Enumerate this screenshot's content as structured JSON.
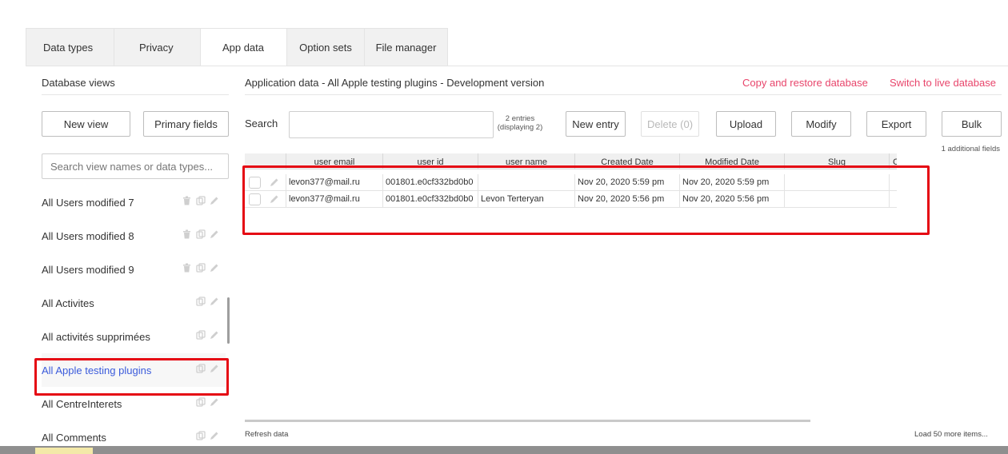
{
  "tabs": [
    {
      "label": "Data types",
      "active": false
    },
    {
      "label": "Privacy",
      "active": false
    },
    {
      "label": "App data",
      "active": true
    },
    {
      "label": "Option sets",
      "active": false
    },
    {
      "label": "File manager",
      "active": false
    }
  ],
  "sidebar": {
    "title": "Database views",
    "new_view_label": "New view",
    "primary_fields_label": "Primary fields",
    "search_placeholder": "Search view names or data types...",
    "items": [
      {
        "label": "All Users modified 7",
        "icons": [
          "trash-icon",
          "copy-icon",
          "pencil-icon"
        ],
        "selected": false
      },
      {
        "label": "All Users modified 8",
        "icons": [
          "trash-icon",
          "copy-icon",
          "pencil-icon"
        ],
        "selected": false
      },
      {
        "label": "All Users modified 9",
        "icons": [
          "trash-icon",
          "copy-icon",
          "pencil-icon"
        ],
        "selected": false
      },
      {
        "label": "All Activites",
        "icons": [
          "copy-icon",
          "pencil-icon"
        ],
        "selected": false
      },
      {
        "label": "All activités supprimées",
        "icons": [
          "copy-icon",
          "pencil-icon"
        ],
        "selected": false
      },
      {
        "label": "All Apple testing plugins",
        "icons": [
          "copy-icon",
          "pencil-icon"
        ],
        "selected": true
      },
      {
        "label": "All CentreInterets",
        "icons": [
          "copy-icon",
          "pencil-icon"
        ],
        "selected": false
      },
      {
        "label": "All Comments",
        "icons": [
          "copy-icon",
          "pencil-icon"
        ],
        "selected": false
      }
    ]
  },
  "main": {
    "title": "Application data - All Apple testing plugins - Development version",
    "copy_restore_label": "Copy and restore database",
    "switch_live_label": "Switch to live database",
    "search_label": "Search",
    "entries_line1": "2 entries",
    "entries_line2": "(displaying 2)",
    "new_entry_label": "New entry",
    "delete_label": "Delete (0)",
    "upload_label": "Upload",
    "modify_label": "Modify",
    "export_label": "Export",
    "bulk_label": "Bulk",
    "additional_fields": "1 additional fields",
    "table": {
      "columns": [
        "user email",
        "user id",
        "user name",
        "Created Date",
        "Modified Date",
        "Slug",
        "C"
      ],
      "rows": [
        [
          "levon377@mail.ru",
          "001801.e0cf332bd0b0",
          "",
          "Nov 20, 2020 5:59 pm",
          "Nov 20, 2020 5:59 pm",
          ""
        ],
        [
          "levon377@mail.ru",
          "001801.e0cf332bd0b0",
          "Levon Terteryan",
          "Nov 20, 2020 5:56 pm",
          "Nov 20, 2020 5:56 pm",
          ""
        ]
      ]
    },
    "refresh_label": "Refresh data",
    "load_more_label": "Load 50 more items..."
  },
  "colors": {
    "accent_red": "#e8456b",
    "highlight_box": "#e50914",
    "selected_text": "#3b5bdb"
  }
}
